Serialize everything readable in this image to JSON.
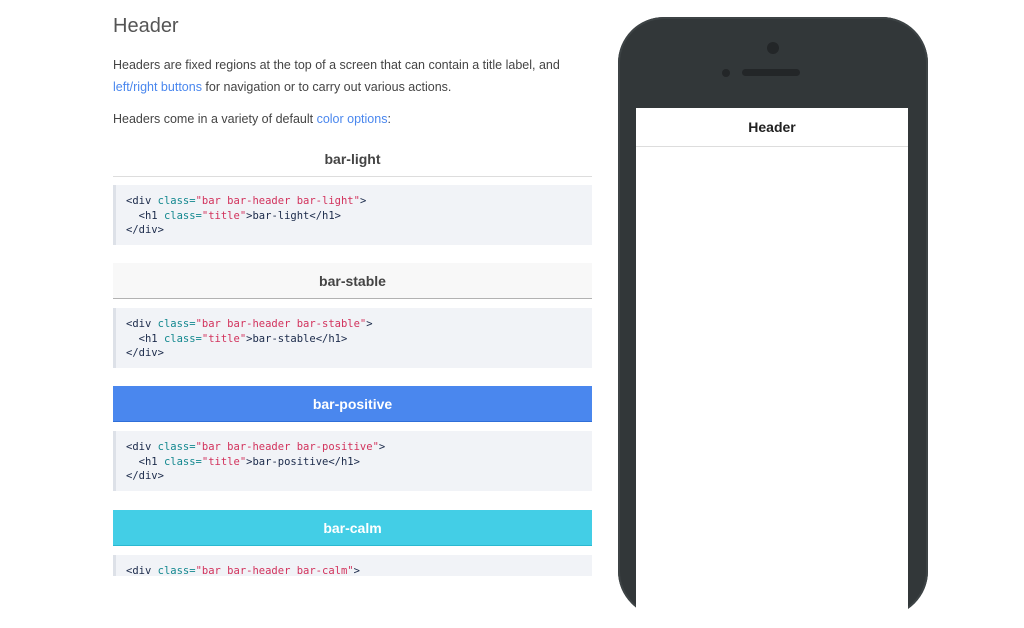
{
  "doc": {
    "title": "Header",
    "intro": {
      "before": "Headers are fixed regions at the top of a screen that can contain a title label, and ",
      "link": "left/right buttons",
      "after": " for navigation or to carry out various actions."
    },
    "variety": {
      "before": "Headers come in a variety of default ",
      "link": "color options",
      "after": ":"
    }
  },
  "examples": [
    {
      "name": "bar-light",
      "code": {
        "open": "<div",
        "attr1": "class=",
        "str1": "\"bar bar-header bar-light\"",
        "close1": ">",
        "h1open": "<h1",
        "attr2": "class=",
        "str2": "\"title\"",
        "h1text": ">bar-light</h1>",
        "end": "</div>"
      }
    },
    {
      "name": "bar-stable",
      "code": {
        "open": "<div",
        "attr1": "class=",
        "str1": "\"bar bar-header bar-stable\"",
        "close1": ">",
        "h1open": "<h1",
        "attr2": "class=",
        "str2": "\"title\"",
        "h1text": ">bar-stable</h1>",
        "end": "</div>"
      }
    },
    {
      "name": "bar-positive",
      "code": {
        "open": "<div",
        "attr1": "class=",
        "str1": "\"bar bar-header bar-positive\"",
        "close1": ">",
        "h1open": "<h1",
        "attr2": "class=",
        "str2": "\"title\"",
        "h1text": ">bar-positive</h1>",
        "end": "</div>"
      }
    },
    {
      "name": "bar-calm",
      "code": {
        "open": "<div",
        "attr1": "class=",
        "str1": "\"bar bar-header bar-calm\"",
        "close1": ">"
      }
    }
  ],
  "phone": {
    "header_title": "Header"
  },
  "colors": {
    "link": "#4a87ee",
    "positive": "#4a87ee",
    "calm": "#43cee6",
    "stable": "#f8f8f8",
    "phone_body": "#323739"
  }
}
